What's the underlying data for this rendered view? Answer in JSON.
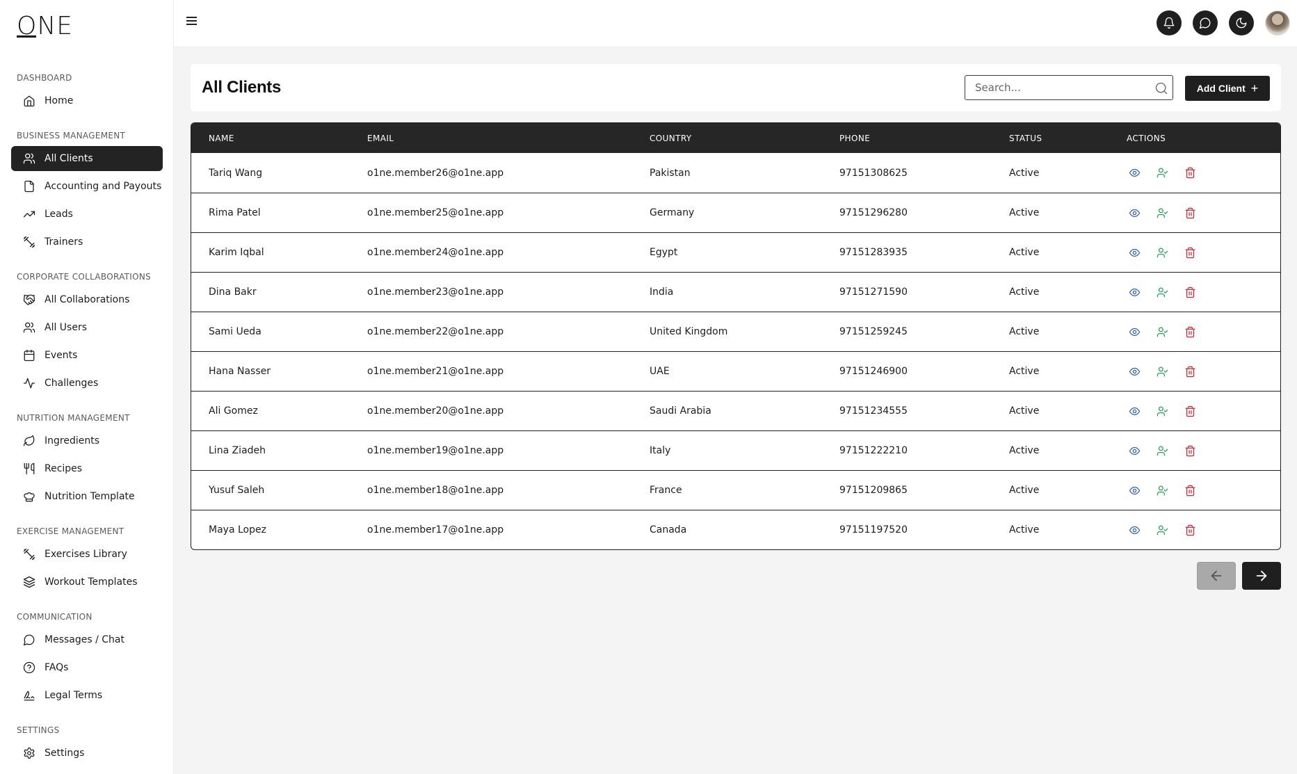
{
  "brand": {
    "logo_text": "ONE"
  },
  "sidebar": {
    "sections": [
      {
        "title": "DASHBOARD",
        "items": [
          {
            "label": "Home",
            "icon": "home-icon"
          }
        ]
      },
      {
        "title": "BUSINESS MANAGEMENT",
        "items": [
          {
            "label": "All Clients",
            "icon": "users-icon",
            "active": true
          },
          {
            "label": "Accounting and Payouts",
            "icon": "file-icon"
          },
          {
            "label": "Leads",
            "icon": "trending-up-icon"
          },
          {
            "label": "Trainers",
            "icon": "dumbbell-icon"
          }
        ]
      },
      {
        "title": "CORPORATE COLLABORATIONS",
        "items": [
          {
            "label": "All Collaborations",
            "icon": "handshake-icon"
          },
          {
            "label": "All Users",
            "icon": "users-icon"
          },
          {
            "label": "Events",
            "icon": "calendar-icon"
          },
          {
            "label": "Challenges",
            "icon": "activity-icon"
          }
        ]
      },
      {
        "title": "NUTRITION MANAGEMENT",
        "items": [
          {
            "label": "Ingredients",
            "icon": "leaf-icon"
          },
          {
            "label": "Recipes",
            "icon": "utensils-icon"
          },
          {
            "label": "Nutrition Template",
            "icon": "chef-hat-icon"
          }
        ]
      },
      {
        "title": "EXERCISE MANAGEMENT",
        "items": [
          {
            "label": "Exercises Library",
            "icon": "dumbbell-icon"
          },
          {
            "label": "Workout Templates",
            "icon": "layers-icon"
          }
        ]
      },
      {
        "title": "COMMUNICATION",
        "items": [
          {
            "label": "Messages / Chat",
            "icon": "message-circle-icon"
          },
          {
            "label": "FAQs",
            "icon": "help-circle-icon"
          },
          {
            "label": "Legal Terms",
            "icon": "signature-icon"
          }
        ]
      },
      {
        "title": "SETTINGS",
        "items": [
          {
            "label": "Settings",
            "icon": "gear-icon"
          }
        ]
      }
    ]
  },
  "topbar": {
    "buttons": [
      {
        "name": "notifications",
        "icon": "bell-icon"
      },
      {
        "name": "messages",
        "icon": "chat-bubble-icon"
      },
      {
        "name": "theme",
        "icon": "moon-icon"
      }
    ]
  },
  "header": {
    "title": "All Clients",
    "search_placeholder": "Search...",
    "add_button_label": "Add Client",
    "add_button_icon": "+"
  },
  "table": {
    "columns": [
      "NAME",
      "EMAIL",
      "COUNTRY",
      "PHONE",
      "STATUS",
      "ACTIONS"
    ],
    "rows": [
      {
        "name": "Tariq Wang",
        "email": "o1ne.member26@o1ne.app",
        "country": "Pakistan",
        "phone": "97151308625",
        "status": "Active"
      },
      {
        "name": "Rima Patel",
        "email": "o1ne.member25@o1ne.app",
        "country": "Germany",
        "phone": "97151296280",
        "status": "Active"
      },
      {
        "name": "Karim Iqbal",
        "email": "o1ne.member24@o1ne.app",
        "country": "Egypt",
        "phone": "97151283935",
        "status": "Active"
      },
      {
        "name": "Dina Bakr",
        "email": "o1ne.member23@o1ne.app",
        "country": "India",
        "phone": "97151271590",
        "status": "Active"
      },
      {
        "name": "Sami Ueda",
        "email": "o1ne.member22@o1ne.app",
        "country": "United Kingdom",
        "phone": "97151259245",
        "status": "Active"
      },
      {
        "name": "Hana Nasser",
        "email": "o1ne.member21@o1ne.app",
        "country": "UAE",
        "phone": "97151246900",
        "status": "Active"
      },
      {
        "name": "Ali Gomez",
        "email": "o1ne.member20@o1ne.app",
        "country": "Saudi Arabia",
        "phone": "97151234555",
        "status": "Active"
      },
      {
        "name": "Lina Ziadeh",
        "email": "o1ne.member19@o1ne.app",
        "country": "Italy",
        "phone": "97151222210",
        "status": "Active"
      },
      {
        "name": "Yusuf Saleh",
        "email": "o1ne.member18@o1ne.app",
        "country": "France",
        "phone": "97151209865",
        "status": "Active"
      },
      {
        "name": "Maya Lopez",
        "email": "o1ne.member17@o1ne.app",
        "country": "Canada",
        "phone": "97151197520",
        "status": "Active"
      }
    ],
    "action_icons": [
      "eye-icon",
      "user-check-icon",
      "trash-icon"
    ]
  },
  "colors": {
    "view": "#2f5fd0",
    "assign": "#23a455",
    "delete": "#d0262e",
    "dark": "#1f1f1f"
  },
  "pagination": {
    "prev_icon": "arrow-left-icon",
    "next_icon": "arrow-right-icon"
  }
}
